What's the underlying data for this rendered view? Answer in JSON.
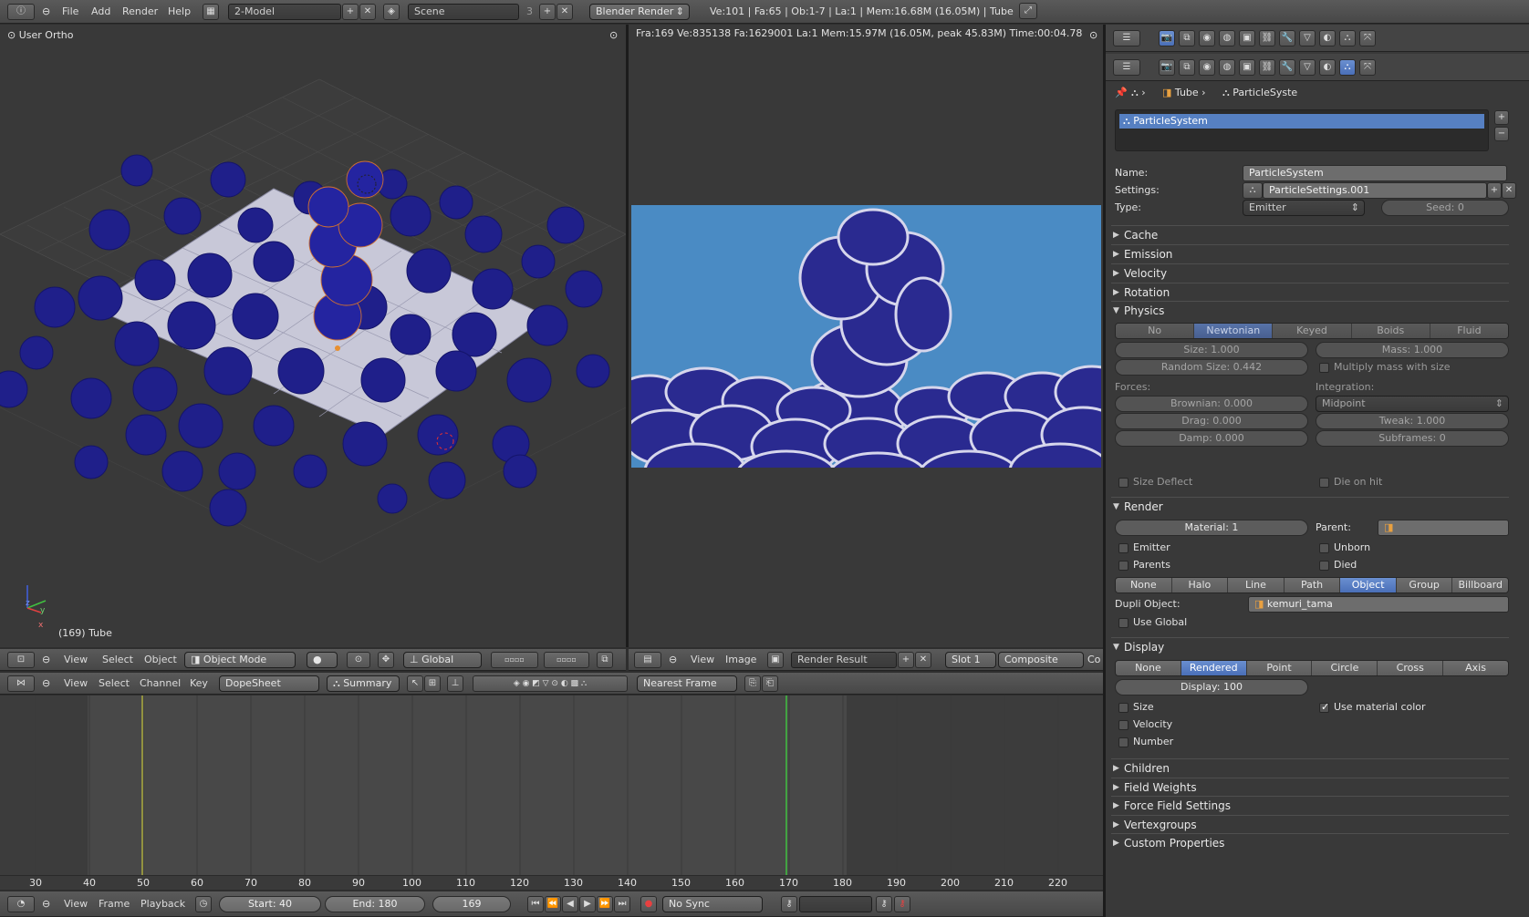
{
  "top": {
    "menus": [
      "File",
      "Add",
      "Render",
      "Help"
    ],
    "layout": "2-Model",
    "scene": "Scene",
    "scene_users": "3",
    "engine": "Blender Render",
    "stats": "Ve:101 | Fa:65 | Ob:1-7 | La:1 | Mem:16.68M (16.05M) | Tube"
  },
  "viewport": {
    "label": "User Ortho",
    "frame_label": "(169) Tube",
    "axis_y": "y",
    "axis_z": "z",
    "axis_x": "x",
    "header": {
      "view": "View",
      "select": "Select",
      "object": "Object",
      "mode": "Object Mode",
      "orientation": "Global"
    }
  },
  "render": {
    "info": "Fra:169  Ve:835138 Fa:1629001 La:1 Mem:15.97M (16.05M, peak 45.83M) Time:00:04.78",
    "header": {
      "view": "View",
      "image": "Image",
      "result": "Render Result",
      "slot": "Slot 1",
      "pass": "Composite",
      "extra": "Co"
    }
  },
  "dopesheet": {
    "view": "View",
    "select": "Select",
    "channel": "Channel",
    "key": "Key",
    "mode": "DopeSheet",
    "summary": "Summary",
    "snap": "Nearest Frame",
    "ticks": [
      "30",
      "40",
      "50",
      "60",
      "70",
      "80",
      "90",
      "100",
      "110",
      "120",
      "130",
      "140",
      "150",
      "160",
      "170",
      "180",
      "190",
      "200",
      "210",
      "220"
    ]
  },
  "timeline": {
    "view": "View",
    "frame": "Frame",
    "playback": "Playback",
    "start": "Start: 40",
    "end": "End: 180",
    "current": "169",
    "sync": "No Sync"
  },
  "props": {
    "breadcrumb": [
      "Tube",
      "ParticleSyste"
    ],
    "list_item": "ParticleSystem",
    "name_label": "Name:",
    "name_value": "ParticleSystem",
    "settings_label": "Settings:",
    "settings_value": "ParticleSettings.001",
    "type_label": "Type:",
    "type_value": "Emitter",
    "seed": "Seed: 0",
    "panels_top": [
      "Cache",
      "Emission",
      "Velocity",
      "Rotation"
    ],
    "physics": {
      "title": "Physics",
      "tabs": [
        "No",
        "Newtonian",
        "Keyed",
        "Boids",
        "Fluid"
      ],
      "selected": 1,
      "size": "Size: 1.000",
      "mass": "Mass: 1.000",
      "random_size": "Random Size: 0.442",
      "multiply": "Multiply mass with size",
      "forces": "Forces:",
      "integration": "Integration:",
      "brownian": "Brownian: 0.000",
      "midpoint": "Midpoint",
      "drag": "Drag: 0.000",
      "tweak": "Tweak: 1.000",
      "damp": "Damp: 0.000",
      "subframes": "Subframes: 0",
      "size_deflect": "Size Deflect",
      "die_on_hit": "Die on hit"
    },
    "render": {
      "title": "Render",
      "material": "Material: 1",
      "parent": "Parent:",
      "emitter": "Emitter",
      "unborn": "Unborn",
      "parents": "Parents",
      "died": "Died",
      "tabs": [
        "None",
        "Halo",
        "Line",
        "Path",
        "Object",
        "Group",
        "Billboard"
      ],
      "selected": 4,
      "dupli_label": "Dupli Object:",
      "dupli_value": "kemuri_tama",
      "use_global": "Use Global"
    },
    "display": {
      "title": "Display",
      "tabs": [
        "None",
        "Rendered",
        "Point",
        "Circle",
        "Cross",
        "Axis"
      ],
      "selected": 1,
      "display": "Display: 100",
      "size": "Size",
      "use_material_color": "Use material color",
      "velocity": "Velocity",
      "number": "Number"
    },
    "panels_bottom": [
      "Children",
      "Field Weights",
      "Force Field Settings",
      "Vertexgroups",
      "Custom Properties"
    ]
  },
  "colors": {
    "accent": "#5680c2",
    "bg": "#393939",
    "particle": "#1f1f8a",
    "sky": "#4a8bc4"
  }
}
